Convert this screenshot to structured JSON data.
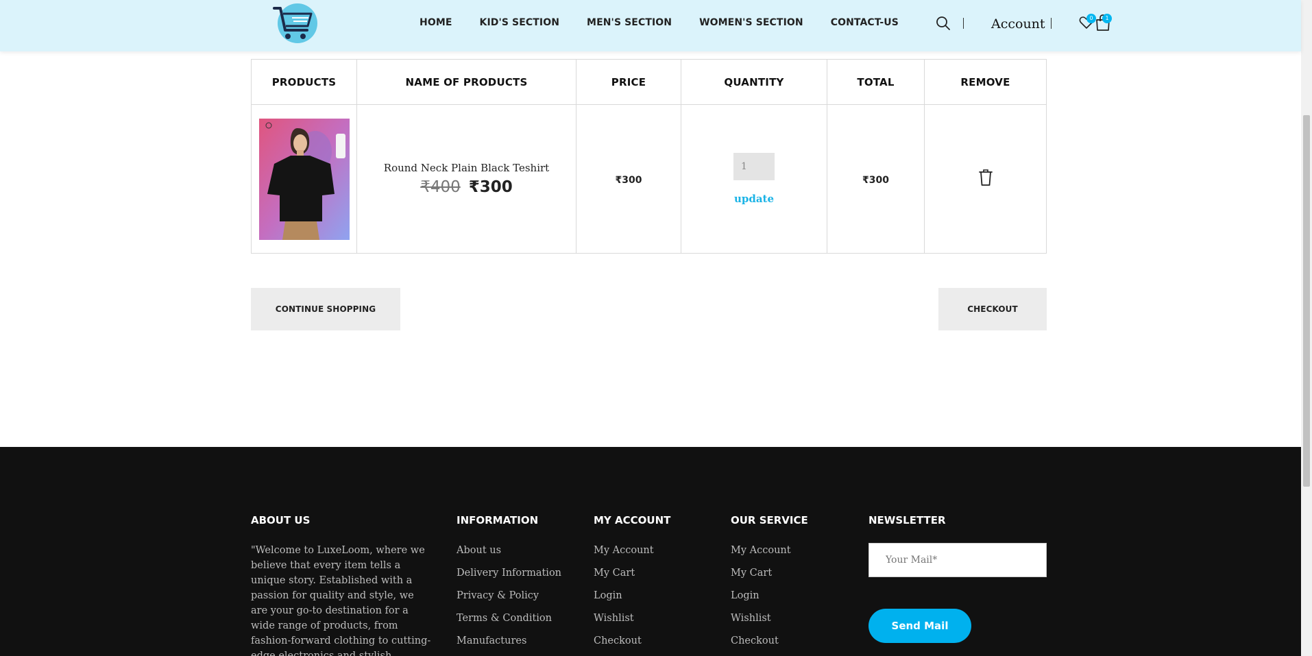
{
  "header": {
    "nav": [
      "HOME",
      "KID'S SECTION",
      "MEN'S SECTION",
      "WOMEN'S SECTION",
      "CONTACT-US"
    ],
    "account_label": "Account",
    "wishlist_count": "0",
    "cart_count": "1",
    "accent_color": "#00b6f0",
    "background_color": "#dbf3fb"
  },
  "cart": {
    "columns": [
      "PRODUCTS",
      "NAME OF PRODUCTS",
      "PRICE",
      "QUANTITY",
      "TOTAL",
      "REMOVE"
    ],
    "items": [
      {
        "name": "Round Neck Plain Black Teshirt",
        "old_price": "₹400",
        "new_price": "₹300",
        "price": "₹300",
        "quantity": "1",
        "update_label": "update",
        "total": "₹300",
        "image_icon": "product-photo-black-tshirt",
        "remove_icon": "trash-icon"
      }
    ],
    "continue_label": "CONTINUE SHOPPING",
    "checkout_label": "CHECKOUT"
  },
  "footer": {
    "about": {
      "title": "ABOUT US",
      "text": "\"Welcome to LuxeLoom, where we believe that every item tells a unique story. Established with a passion for quality and style, we are your go-to destination for a wide range of products, from fashion-forward clothing to cutting-edge electronics and stylish footwear. At LuxeLoom"
    },
    "information": {
      "title": "INFORMATION",
      "links": [
        "About us",
        "Delivery Information",
        "Privacy & Policy",
        "Terms & Condition",
        "Manufactures"
      ]
    },
    "my_account": {
      "title": "MY ACCOUNT",
      "links": [
        "My Account",
        "My Cart",
        "Login",
        "Wishlist",
        "Checkout"
      ]
    },
    "our_service": {
      "title": "OUR SERVICE",
      "links": [
        "My Account",
        "My Cart",
        "Login",
        "Wishlist",
        "Checkout"
      ]
    },
    "newsletter": {
      "title": "NEWSLETTER",
      "placeholder": "Your Mail*",
      "button": "Send Mail",
      "button_color": "#00b1ee"
    },
    "background_color": "#111111"
  }
}
